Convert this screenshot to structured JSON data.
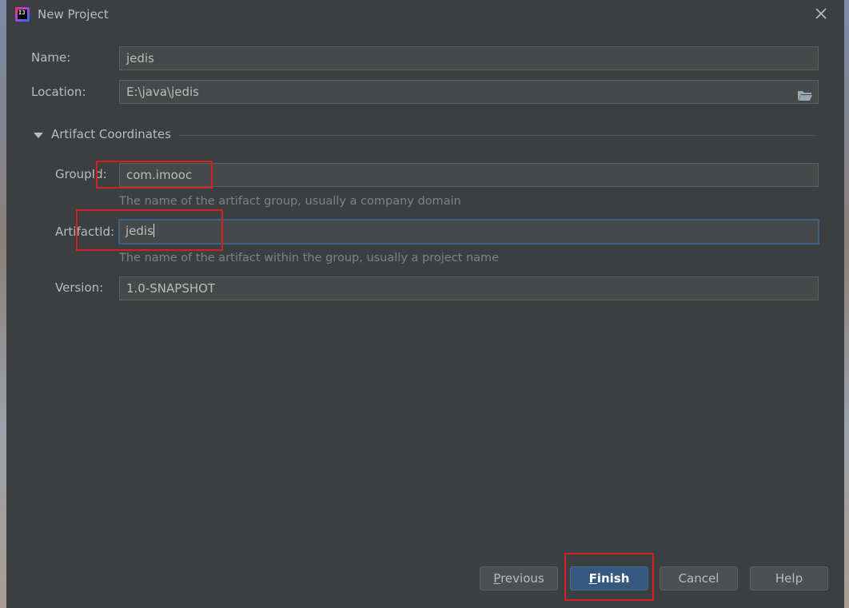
{
  "window": {
    "title": "New Project",
    "app_icon_text": "IJ"
  },
  "form": {
    "name": {
      "label": "Name:",
      "value": "jedis"
    },
    "location": {
      "label": "Location:",
      "value": "E:\\java\\jedis"
    }
  },
  "artifact": {
    "section_title": "Artifact Coordinates",
    "group_id": {
      "label": "GroupId:",
      "value": "com.imooc",
      "hint": "The name of the artifact group, usually a company domain"
    },
    "artifact_id": {
      "label": "ArtifactId:",
      "value": "jedis",
      "hint": "The name of the artifact within the group, usually a project name"
    },
    "version": {
      "label": "Version:",
      "value": "1.0-SNAPSHOT"
    }
  },
  "buttons": {
    "previous": {
      "mnemonic": "P",
      "rest": "revious"
    },
    "finish": {
      "mnemonic": "F",
      "rest": "inish"
    },
    "cancel": "Cancel",
    "help": "Help"
  },
  "colors": {
    "dialog_bg": "#3c3f41",
    "field_bg": "#45494a",
    "focus_border": "#3d6185",
    "primary_button": "#365880",
    "annotation_red": "#d32020"
  }
}
